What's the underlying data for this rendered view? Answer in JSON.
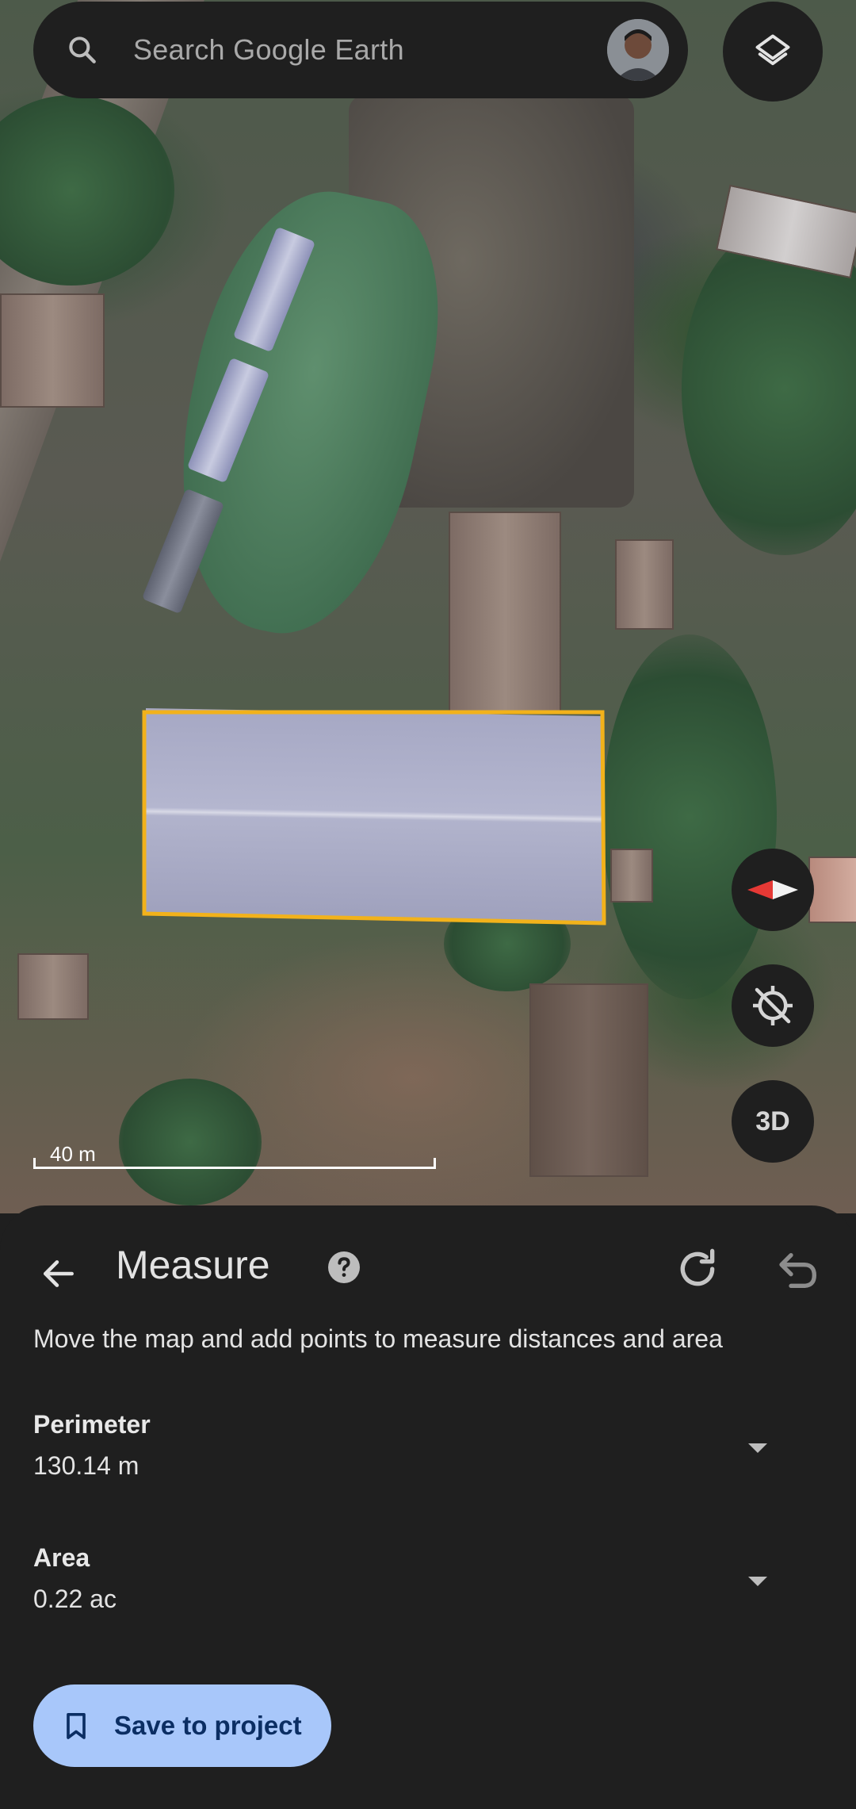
{
  "search": {
    "placeholder": "Search Google Earth"
  },
  "map": {
    "scale_label": "40 m",
    "measure_outline_color": "#f2b21b",
    "mode_button_label": "3D"
  },
  "icons": {
    "search": "search-icon",
    "avatar": "user-avatar",
    "layers": "layers-icon",
    "compass": "compass-icon",
    "location": "my-location-off-icon",
    "back": "arrow-back-icon",
    "help": "help-icon",
    "redo": "redo-icon",
    "undo": "undo-icon",
    "dropdown": "chevron-down-icon",
    "bookmark": "bookmark-icon"
  },
  "measure": {
    "title": "Measure",
    "instructions": "Move the map and add points to measure distances and area",
    "perimeter": {
      "label": "Perimeter",
      "value": "130.14 m"
    },
    "area": {
      "label": "Area",
      "value": "0.22 ac"
    },
    "save_label": "Save to project"
  },
  "colors": {
    "panel_bg": "#1f1f1f",
    "primary_button": "#a8c7fa",
    "primary_button_text": "#0b2e63",
    "compass_red": "#e53935"
  }
}
